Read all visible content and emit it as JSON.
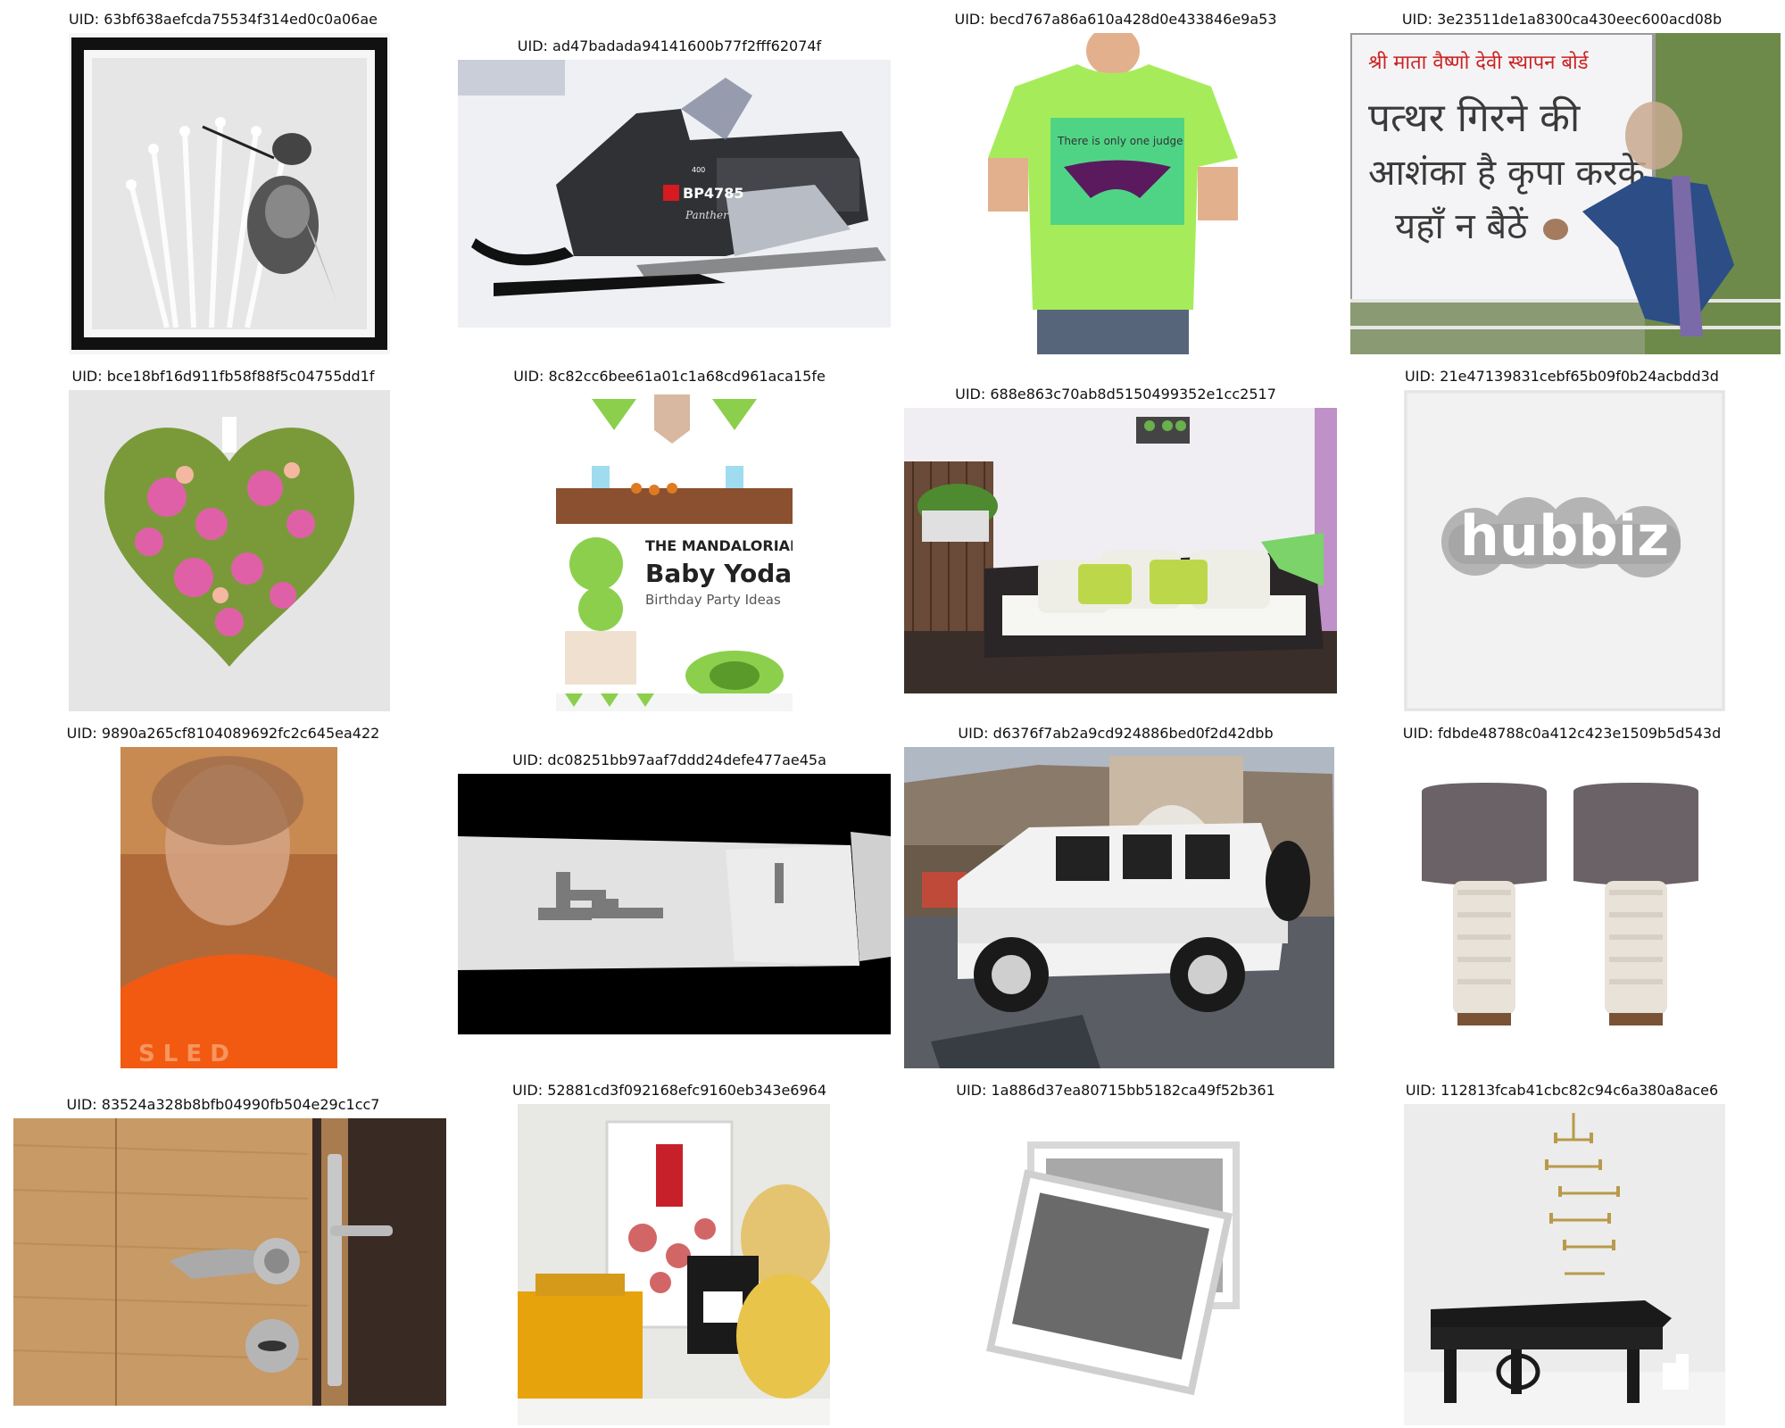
{
  "uid_prefix": "UID: ",
  "grid": [
    {
      "uid": "63bf638aefcda75534f314ed0c0a06ae",
      "subject": "grayscale fly on flower stamens with black border"
    },
    {
      "uid": "ad47badada94141600b77f2fff62074f",
      "subject": "black snowmobile on snow",
      "plate": "BP4785",
      "model": "400",
      "brand": "Panther"
    },
    {
      "uid": "becd767a86a610a428d0e433846e9a53",
      "subject": "man wearing green t-shirt",
      "shirt_text": "There is only one judge"
    },
    {
      "uid": "3e23511de1a8300ca430eec600acd08b",
      "subject": "person at sign with Hindi text",
      "sign_line1": "श्री माता वैष्णो देवी स्थापन बोर्ड",
      "sign_line2": "पत्थर गिरने की",
      "sign_line3": "आशंका है कृपा करके",
      "sign_line4": "यहाँ न बैठें"
    },
    {
      "uid": "bce18bf16d911fb58f88f5c04755dd1f",
      "subject": "heart shaped ornament with pink orchids"
    },
    {
      "uid": "8c82cc6bee61a01c1a68cd961aca15fe",
      "subject": "birthday party collage",
      "title1": "THE MANDALORIAN",
      "title2": "Baby Yoda",
      "title3": "Birthday Party Ideas"
    },
    {
      "uid": "688e863c70ab8d5150499352e1cc2517",
      "subject": "outdoor sofa with green cushions on balcony"
    },
    {
      "uid": "21e47139831cebf65b09f0b24acbdd3d",
      "subject": "blurry hubbiz logo",
      "logo_text": "hubbiz"
    },
    {
      "uid": "9890a265cf8104089692fc2c645ea422",
      "subject": "blurred person in orange shirt"
    },
    {
      "uid": "dc08251bb97aaf7ddd24defe477ae45a",
      "subject": "pixelated handwriting on paper strip"
    },
    {
      "uid": "d6376f7ab2a9cd924886bed0f2d42dbb",
      "subject": "white jeep in parking lot"
    },
    {
      "uid": "fdbde48788c0a412c423e1509b5d543d",
      "subject": "pair of table lamps"
    },
    {
      "uid": "83524a328b8bfb04990fb504e29c1cc7",
      "subject": "wooden door with lever handle"
    },
    {
      "uid": "52881cd3f092168efc9160eb343e6964",
      "subject": "perfume bottles"
    },
    {
      "uid": "1a886d37ea80715bb5182ca49f52b361",
      "subject": "placeholder photo icon"
    },
    {
      "uid": "112813fcab41cbc82c94c6a380a8ace6",
      "subject": "grand piano with brass chandelier"
    }
  ],
  "colors": {
    "tshirt_green": "#a6ec5a",
    "orange_shirt": "#f25a12",
    "snow": "#eef0f4",
    "jeep_white": "#f2f2f2",
    "wood": "#c79a66"
  }
}
